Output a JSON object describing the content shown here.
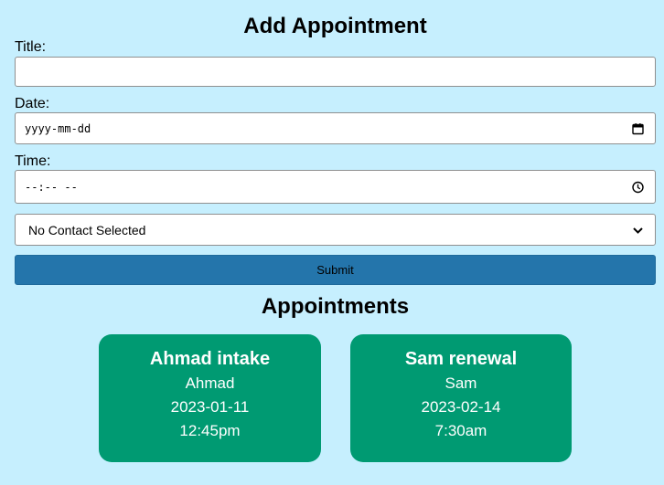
{
  "form": {
    "heading": "Add Appointment",
    "title_label": "Title:",
    "title_value": "",
    "date_label": "Date:",
    "date_placeholder": "yyyy-mm-dd",
    "time_label": "Time:",
    "time_placeholder": "--:-- --",
    "contact_selected": "No Contact Selected",
    "submit_label": "Submit"
  },
  "appointments": {
    "heading": "Appointments",
    "items": [
      {
        "title": "Ahmad intake",
        "contact": "Ahmad",
        "date": "2023-01-11",
        "time": "12:45pm"
      },
      {
        "title": "Sam renewal",
        "contact": "Sam",
        "date": "2023-02-14",
        "time": "7:30am"
      }
    ]
  },
  "colors": {
    "background": "#c6effe",
    "submit": "#2475ab",
    "card": "#009a72"
  }
}
